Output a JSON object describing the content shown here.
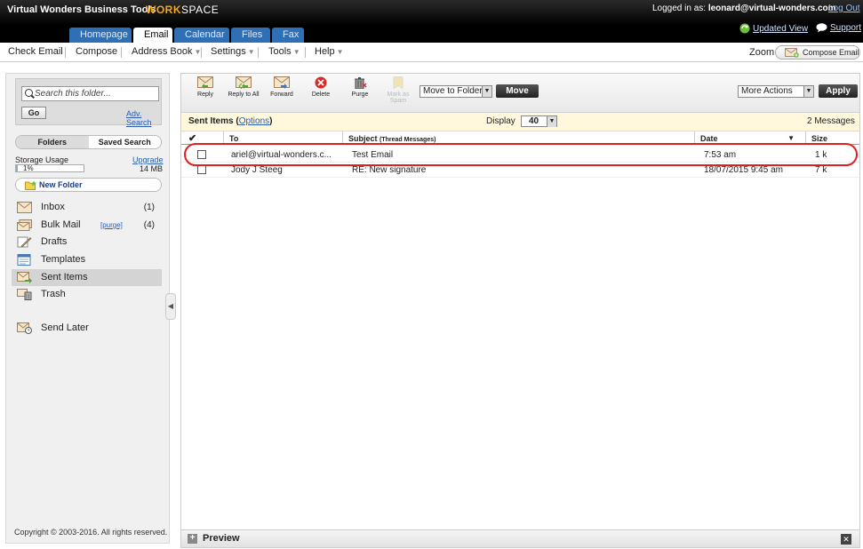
{
  "header": {
    "brand": "Virtual Wonders Business Tools",
    "logo_work": "WORK",
    "logo_space": "SPACE",
    "logged_in_label": "Logged in as:",
    "user": "leonard@virtual-wonders.com",
    "logout": "Log Out",
    "updated_view": "Updated View",
    "support": "Support"
  },
  "tabs": [
    {
      "label": "Homepage"
    },
    {
      "label": "Email"
    },
    {
      "label": "Calendar"
    },
    {
      "label": "Files"
    },
    {
      "label": "Fax"
    }
  ],
  "subnav": {
    "check_email": "Check Email",
    "compose": "Compose",
    "address_book": "Address Book",
    "settings": "Settings",
    "tools": "Tools",
    "help": "Help",
    "zoom": "Zoom",
    "compose_email": "Compose Email"
  },
  "sidebar": {
    "search_placeholder": "Search this folder...",
    "go": "Go",
    "adv_search": "Adv. Search",
    "toggle_folders": "Folders",
    "toggle_saved": "Saved Search",
    "storage_usage": "Storage Usage",
    "upgrade": "Upgrade",
    "storage_pct": "1%",
    "storage_fraction": 0.01,
    "storage_size": "14 MB",
    "new_folder": "New Folder",
    "folders": [
      {
        "label": "Inbox",
        "count": "(1)"
      },
      {
        "label": "Bulk Mail",
        "purge": "[purge]",
        "count": "(4)"
      },
      {
        "label": "Drafts",
        "count": ""
      },
      {
        "label": "Templates",
        "count": ""
      },
      {
        "label": "Sent Items",
        "count": ""
      },
      {
        "label": "Trash",
        "count": ""
      },
      {
        "label": "Send Later",
        "count": ""
      }
    ],
    "copyright": "Copyright © 2003-2016. All rights reserved."
  },
  "toolbar": {
    "reply": "Reply",
    "reply_all": "Reply to All",
    "forward": "Forward",
    "delete": "Delete",
    "purge": "Purge",
    "mark_spam_1": "Mark as",
    "mark_spam_2": "Spam",
    "move_to_folder": "Move to Folder",
    "move": "Move",
    "more_actions": "More Actions",
    "apply": "Apply"
  },
  "list": {
    "folder": "Sent Items",
    "options": "Options",
    "display_label": "Display",
    "display_value": "40",
    "message_count": "2 Messages",
    "columns": {
      "to": "To",
      "subject": "Subject",
      "subject_sub": "(Thread Messages)",
      "date": "Date",
      "size": "Size"
    },
    "rows": [
      {
        "to": "ariel@virtual-wonders.c...",
        "subject": "Test Email",
        "date": "7:53 am",
        "size": "1 k"
      },
      {
        "to": "Jody J Steeg",
        "subject": "RE: New signature",
        "date": "18/07/2015 9:45 am",
        "size": "7 k"
      }
    ]
  },
  "preview": {
    "label": "Preview"
  }
}
